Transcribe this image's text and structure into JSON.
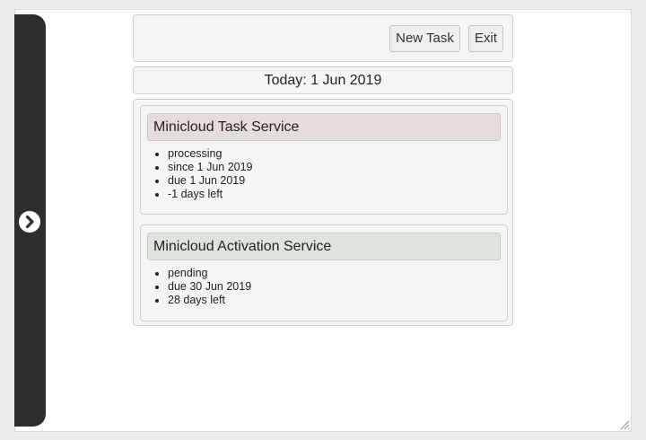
{
  "toolbar": {
    "new_task_label": "New Task",
    "exit_label": "Exit"
  },
  "date_bar": {
    "text": "Today: 1 Jun 2019"
  },
  "tasks": [
    {
      "title": "Minicloud Task Service",
      "status_color": "#e6dcdc",
      "details": [
        "processing",
        "since 1 Jun 2019",
        "due 1 Jun 2019",
        "-1 days left"
      ]
    },
    {
      "title": "Minicloud Activation Service",
      "status_color": "#dce4dc",
      "details": [
        "pending",
        "due 30 Jun 2019",
        "28 days left"
      ]
    }
  ],
  "sidebar": {
    "toggle_icon": "chevron-right-circle-icon"
  }
}
